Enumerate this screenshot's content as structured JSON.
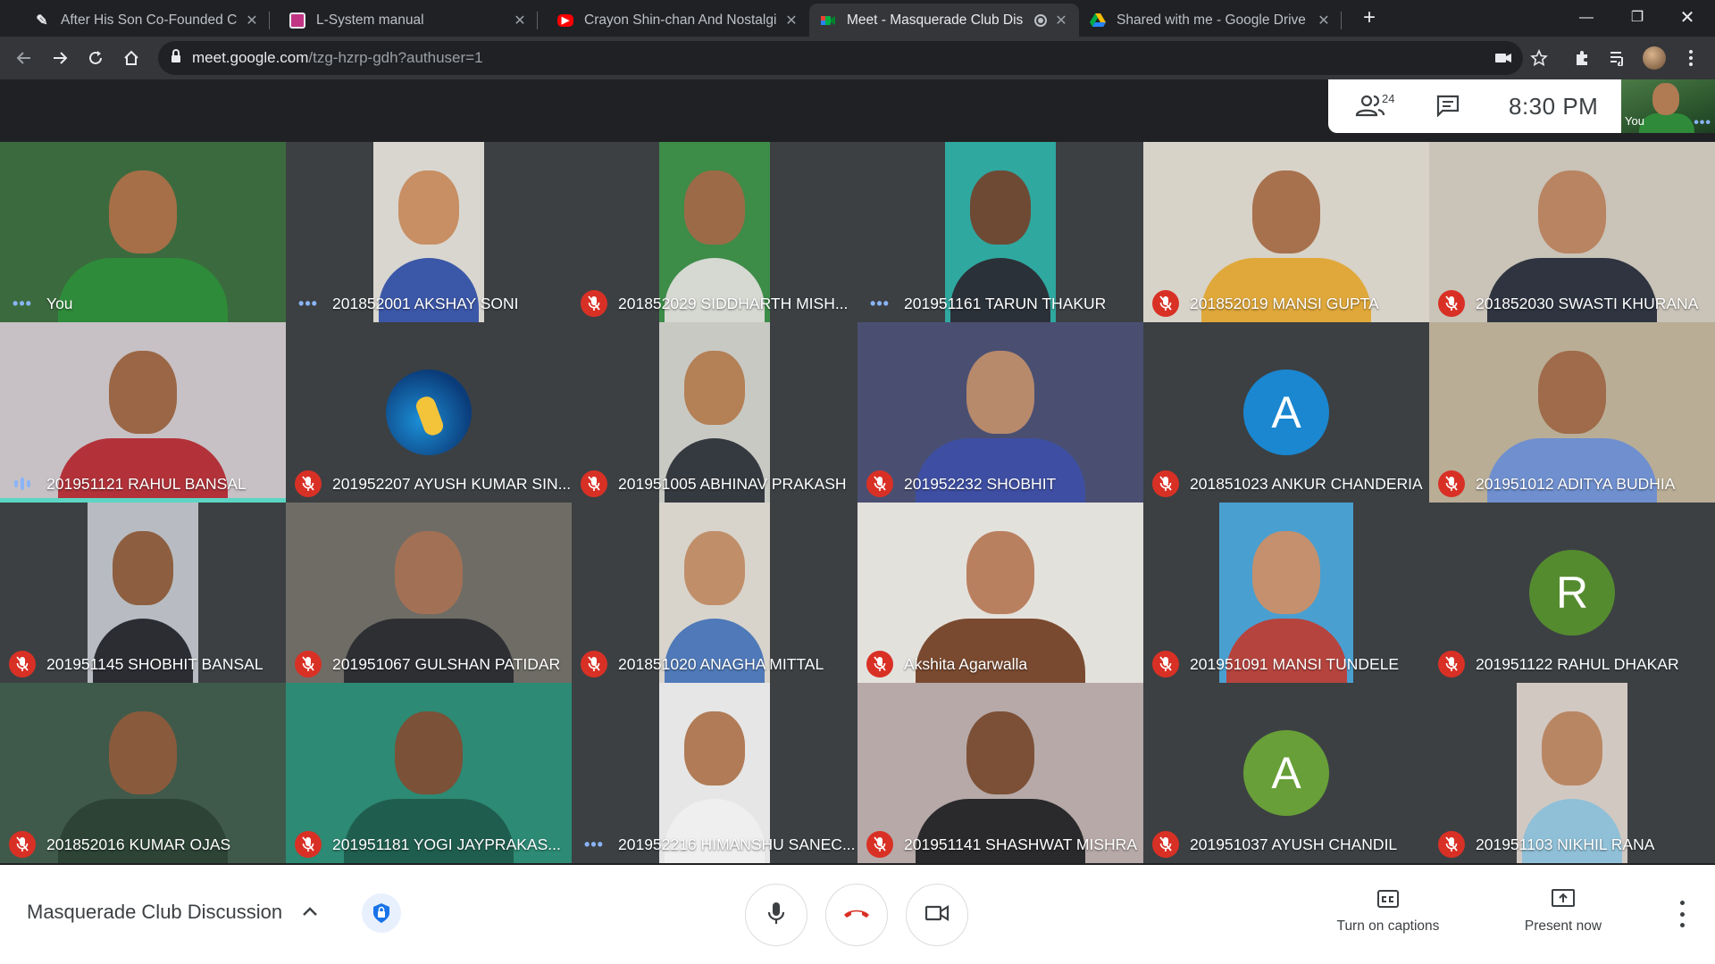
{
  "browser": {
    "tabs": [
      {
        "title": "After His Son Co-Founded Cours",
        "favicon_color": "#ffffff",
        "active": false
      },
      {
        "title": "L-System manual",
        "favicon_color": "#c13584",
        "active": false
      },
      {
        "title": "Crayon Shin-chan And Nostalgia",
        "favicon_color": "#ff0000",
        "active": false
      },
      {
        "title": "Meet - Masquerade Club Dis",
        "favicon_color": "#00832d",
        "active": true
      },
      {
        "title": "Shared with me - Google Drive",
        "favicon_color": "#fbbc04",
        "active": false
      }
    ],
    "new_tab_label": "+",
    "url_host": "meet.google.com",
    "url_path": "/tzg-hzrp-gdh?authuser=1"
  },
  "meet": {
    "participant_count": "24",
    "clock": "8:30  PM",
    "self_label": "You",
    "meeting_title": "Masquerade Club Discussion",
    "captions_label": "Turn on captions",
    "present_label": "Present now",
    "participants": [
      {
        "name": "You",
        "status": "dots",
        "kind": "video",
        "bg": "#3b6a3e",
        "shirt": "#2e8b3a",
        "skin": "#a66f48",
        "vid_w": 320
      },
      {
        "name": "201852001 AKSHAY SONI",
        "status": "dots",
        "kind": "video",
        "bg": "#d9d6d0",
        "shirt": "#3b57a8",
        "skin": "#c78f63",
        "vid_w": 124
      },
      {
        "name": "201852029 SIDDHARTH MISH...",
        "status": "muted",
        "kind": "video",
        "bg": "#3d8c48",
        "shirt": "#d6d8d2",
        "skin": "#9d6a47",
        "vid_w": 124
      },
      {
        "name": "201951161 TARUN THAKUR",
        "status": "dots",
        "kind": "video",
        "bg": "#2fa8a0",
        "shirt": "#2b3138",
        "skin": "#6e4a35",
        "vid_w": 124
      },
      {
        "name": "201852019 MANSI GUPTA",
        "status": "muted",
        "kind": "video",
        "bg": "#d8d3c8",
        "shirt": "#e0a83a",
        "skin": "#a8714e",
        "vid_w": 320
      },
      {
        "name": "201852030 SWASTI KHURANA",
        "status": "muted",
        "kind": "video",
        "bg": "#c9c3b8",
        "shirt": "#2f3440",
        "skin": "#b98461",
        "vid_w": 320
      },
      {
        "name": "201951121 RAHUL BANSAL",
        "status": "bars",
        "kind": "video",
        "bg": "#c7c1c5",
        "shirt": "#b3323a",
        "skin": "#9a6645",
        "vid_w": 320,
        "speaking": true
      },
      {
        "name": "201952207 AYUSH KUMAR SIN...",
        "status": "muted",
        "kind": "photo-avatar"
      },
      {
        "name": "201951005 ABHINAV PRAKASH",
        "status": "muted",
        "kind": "video",
        "bg": "#c9c9c4",
        "shirt": "#353a40",
        "skin": "#b48055",
        "vid_w": 124
      },
      {
        "name": "201952232 SHOBHIT",
        "status": "muted",
        "kind": "video",
        "bg": "#4a4f72",
        "shirt": "#3e4fa3",
        "skin": "#b78a6c",
        "vid_w": 320
      },
      {
        "name": "201851023 ANKUR CHANDERIA",
        "status": "muted",
        "kind": "letter",
        "letter": "A",
        "avatar_color": "#1a87d0"
      },
      {
        "name": "201951012 ADITYA BUDHIA",
        "status": "muted",
        "kind": "video",
        "bg": "#b9ad96",
        "shirt": "#6f8fcf",
        "skin": "#9f6b4a",
        "vid_w": 320
      },
      {
        "name": "201951145 SHOBHIT BANSAL",
        "status": "muted",
        "kind": "video",
        "bg": "#b8bcc2",
        "shirt": "#2b2d33",
        "skin": "#8d5f40",
        "vid_w": 124
      },
      {
        "name": "201951067 GULSHAN PATIDAR",
        "status": "muted",
        "kind": "video",
        "bg": "#6f6c66",
        "shirt": "#2d2f33",
        "skin": "#a27155",
        "vid_w": 320
      },
      {
        "name": "201851020 ANAGHA MITTAL",
        "status": "muted",
        "kind": "video",
        "bg": "#d8d4cc",
        "shirt": "#4f79b8",
        "skin": "#c08f6a",
        "vid_w": 124
      },
      {
        "name": "Akshita Agarwalla",
        "status": "muted",
        "kind": "video",
        "bg": "#e3e1dc",
        "shirt": "#7a4a30",
        "skin": "#b98060",
        "vid_w": 320
      },
      {
        "name": "201951091 MANSI TUNDELE",
        "status": "muted",
        "kind": "video",
        "bg": "#4a9fd1",
        "shirt": "#b6443e",
        "skin": "#c4906d",
        "vid_w": 150
      },
      {
        "name": "201951122 RAHUL DHAKAR",
        "status": "muted",
        "kind": "letter",
        "letter": "R",
        "avatar_color": "#558b2f"
      },
      {
        "name": "201852016 KUMAR OJAS",
        "status": "muted",
        "kind": "video",
        "bg": "#3f5a4b",
        "shirt": "#2c4336",
        "skin": "#8a5a3c",
        "vid_w": 320
      },
      {
        "name": "201951181 YOGI JAYPRAKAS...",
        "status": "muted",
        "kind": "video",
        "bg": "#2d8a74",
        "shirt": "#1f5e4e",
        "skin": "#7b5138",
        "vid_w": 320
      },
      {
        "name": "201952216 HIMANSHU SANEC...",
        "status": "dots",
        "kind": "video",
        "bg": "#e6e6e6",
        "shirt": "#efefef",
        "skin": "#b07b56",
        "vid_w": 124
      },
      {
        "name": "201951141 SHASHWAT MISHRA",
        "status": "muted",
        "kind": "video",
        "bg": "#b6a9a8",
        "shirt": "#2a2a2c",
        "skin": "#7c5036",
        "vid_w": 320
      },
      {
        "name": "201951037 AYUSH CHANDIL",
        "status": "muted",
        "kind": "letter",
        "letter": "A",
        "avatar_color": "#689f38"
      },
      {
        "name": "201951103 NIKHIL RANA",
        "status": "muted",
        "kind": "video",
        "bg": "#d2c8c2",
        "shirt": "#8fc0d8",
        "skin": "#b98663",
        "vid_w": 124
      }
    ]
  }
}
